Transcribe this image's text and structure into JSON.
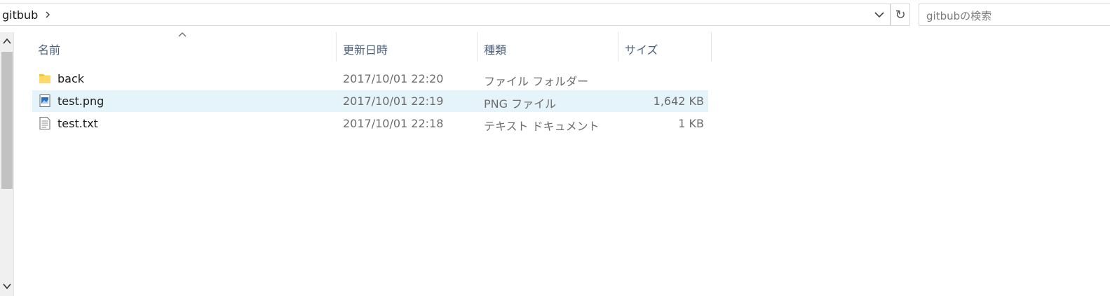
{
  "address": {
    "path": "gitbub"
  },
  "search": {
    "placeholder": "gitbubの検索"
  },
  "columns": {
    "name": "名前",
    "date": "更新日時",
    "type": "種類",
    "size": "サイズ"
  },
  "files": [
    {
      "name": "back",
      "date": "2017/10/01 22:20",
      "type": "ファイル フォルダー",
      "size": "",
      "icon": "folder-icon"
    },
    {
      "name": "test.png",
      "date": "2017/10/01 22:19",
      "type": "PNG ファイル",
      "size": "1,642 KB",
      "icon": "image-file-icon"
    },
    {
      "name": "test.txt",
      "date": "2017/10/01 22:18",
      "type": "テキスト ドキュメント",
      "size": "1 KB",
      "icon": "text-file-icon"
    }
  ],
  "colors": {
    "selection": "#e5f3fb",
    "header_text": "#4c607a"
  }
}
